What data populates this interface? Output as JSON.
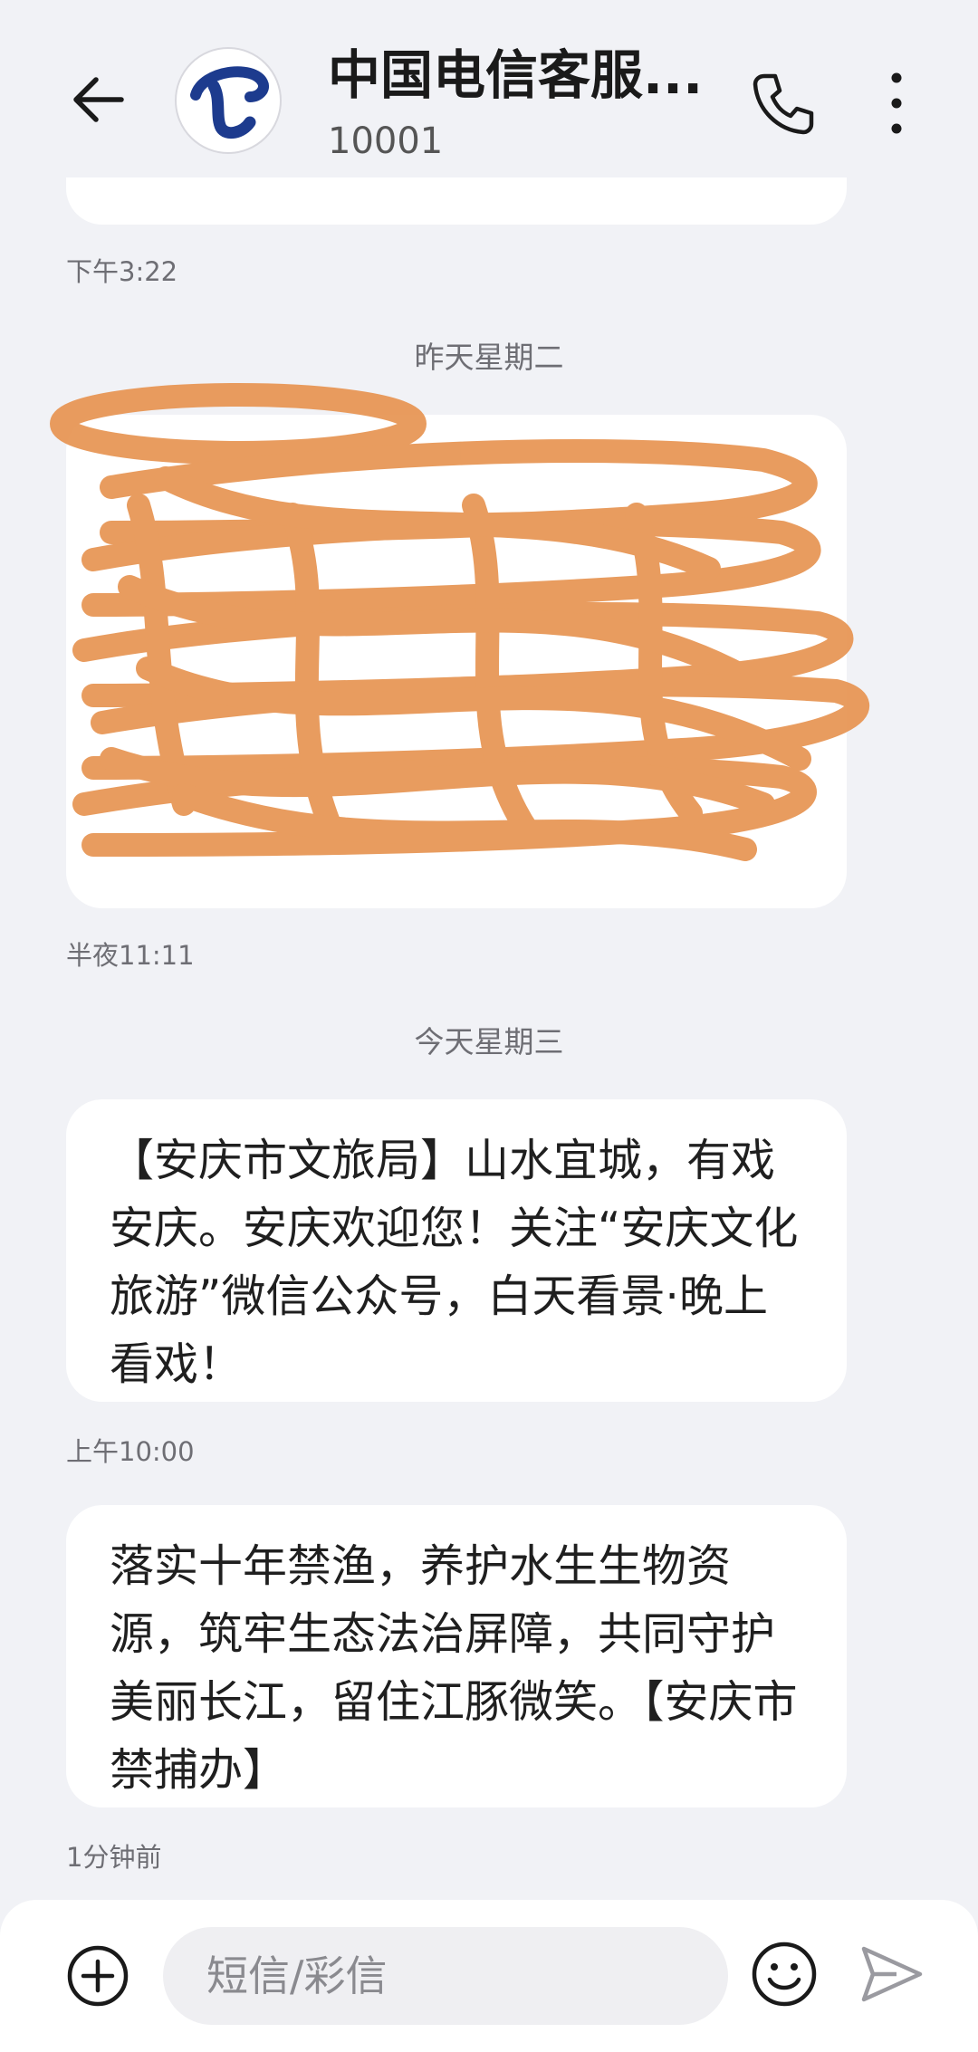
{
  "header": {
    "contact_name": "中国电信客服...",
    "contact_number": "10001"
  },
  "messages": [
    {
      "time": "下午3:22"
    },
    {
      "day": "昨天星期二",
      "time": "半夜11:11",
      "redacted": true
    },
    {
      "day": "今天星期三",
      "text": "【安庆市文旅局】山水宜城，有戏安庆。安庆欢迎您！关注“安庆文化旅游”微信公众号，白天看景·晚上看戏！",
      "time": "上午10:00"
    },
    {
      "text": "落实十年禁渔，养护水生生物资源，筑牢生态法治屏障，共同守护美丽长江，留住江豚微笑。【安庆市禁捕办】",
      "time": "1分钟前"
    }
  ],
  "composer": {
    "placeholder": "短信/彩信"
  },
  "icons": {
    "back": "arrow-left-icon",
    "call": "phone-icon",
    "more": "more-vertical-icon",
    "add": "plus-circle-icon",
    "emoji": "smiley-icon",
    "send": "send-icon"
  },
  "colors": {
    "background": "#f1f2f6",
    "bubble": "#ffffff",
    "avatar_logo": "#1d3b8e",
    "scribble": "#e8995a",
    "link_partial_bar": "#2b5bd8"
  }
}
